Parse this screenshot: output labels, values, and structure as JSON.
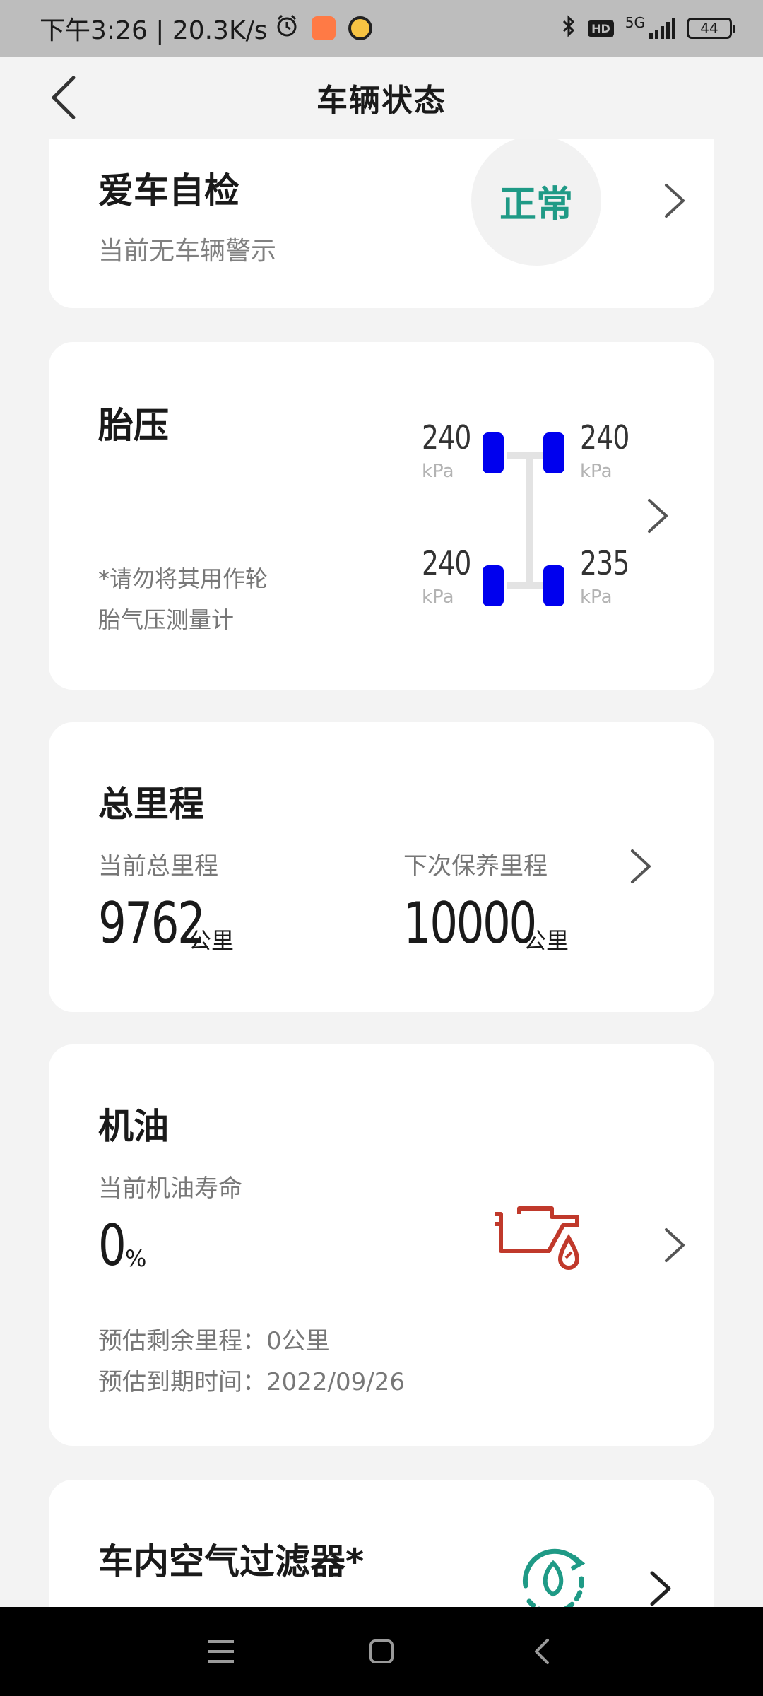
{
  "status_bar": {
    "time_speed": "下午3:26 | 20.3K/s",
    "network": "5G",
    "hd": "HD",
    "battery": "44"
  },
  "header": {
    "title": "车辆状态"
  },
  "self_check": {
    "title": "爱车自检",
    "subtitle": "当前无车辆警示",
    "status": "正常",
    "status_color": "#1f9a86"
  },
  "tire_pressure": {
    "title": "胎压",
    "note_line1": "*请勿将其用作轮",
    "note_line2": "胎气压测量计",
    "front_left": "240",
    "front_right": "240",
    "rear_left": "240",
    "rear_right": "235",
    "unit": "kPa",
    "tire_color": "#0000ee"
  },
  "mileage": {
    "title": "总里程",
    "current_label": "当前总里程",
    "current_value": "9762",
    "next_label": "下次保养里程",
    "next_value": "10000",
    "unit": "公里"
  },
  "oil": {
    "title": "机油",
    "life_label": "当前机油寿命",
    "life_value": "0",
    "life_unit": "%",
    "remaining": "预估剩余里程：0公里",
    "due": "预估到期时间：2022/09/26",
    "icon_color": "#c0392b"
  },
  "air_filter": {
    "title": "车内空气过滤器*",
    "icon_color": "#1f9a86"
  }
}
